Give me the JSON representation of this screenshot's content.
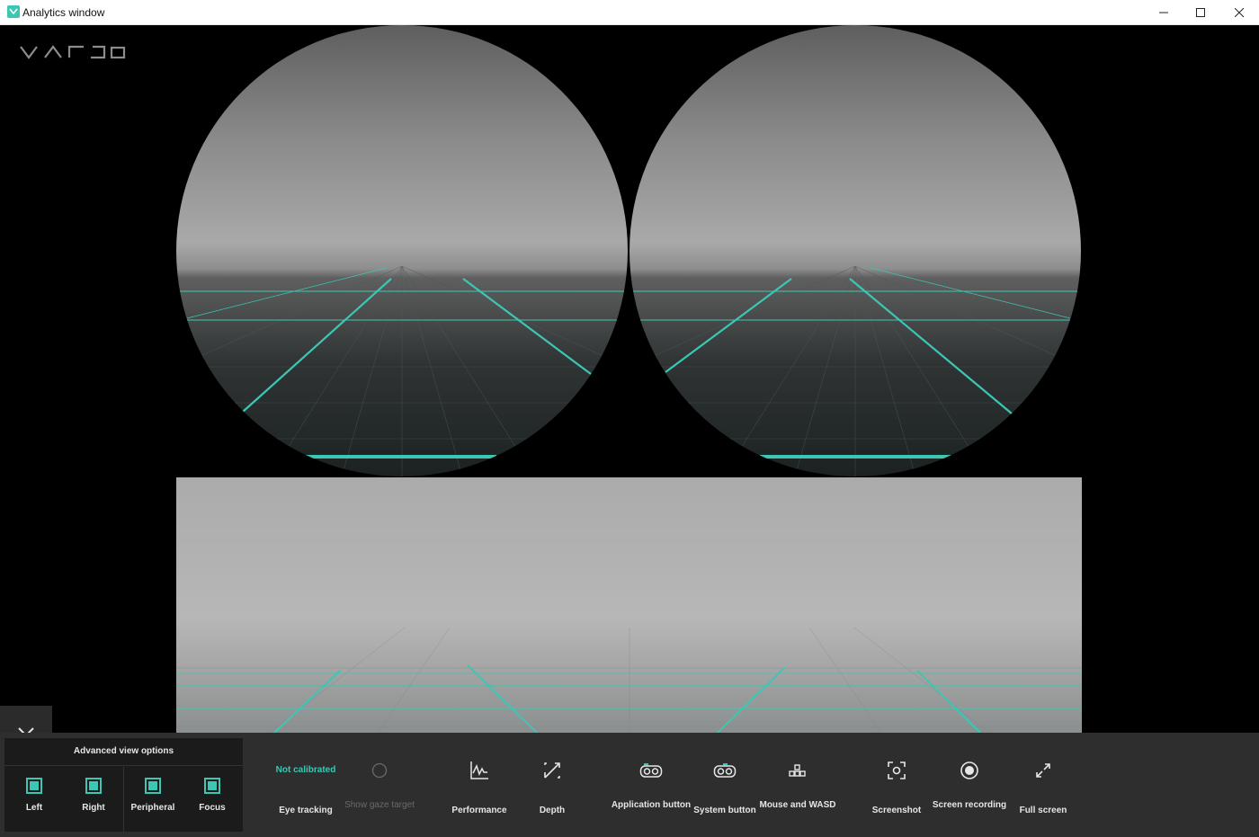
{
  "window": {
    "title": "Analytics window",
    "controls": [
      "minimize-icon",
      "maximize-icon",
      "close-icon"
    ]
  },
  "brand": {
    "logo_text": "VARJO",
    "accent_color": "#3cc7b4"
  },
  "advanced": {
    "title": "Advanced view options",
    "options": [
      {
        "label": "Left",
        "checked": true
      },
      {
        "label": "Right",
        "checked": true
      },
      {
        "label": "Peripheral",
        "checked": true
      },
      {
        "label": "Focus",
        "checked": true
      }
    ]
  },
  "eye_tracking": {
    "status": "Not calibrated",
    "label": "Eye tracking"
  },
  "tools": {
    "show_gaze": "Show gaze target",
    "performance": "Performance",
    "depth": "Depth",
    "application_button": "Application button",
    "system_button": "System button",
    "mouse_wasd": "Mouse and WASD",
    "screenshot": "Screenshot",
    "screen_recording": "Screen recording",
    "full_screen": "Full screen"
  }
}
